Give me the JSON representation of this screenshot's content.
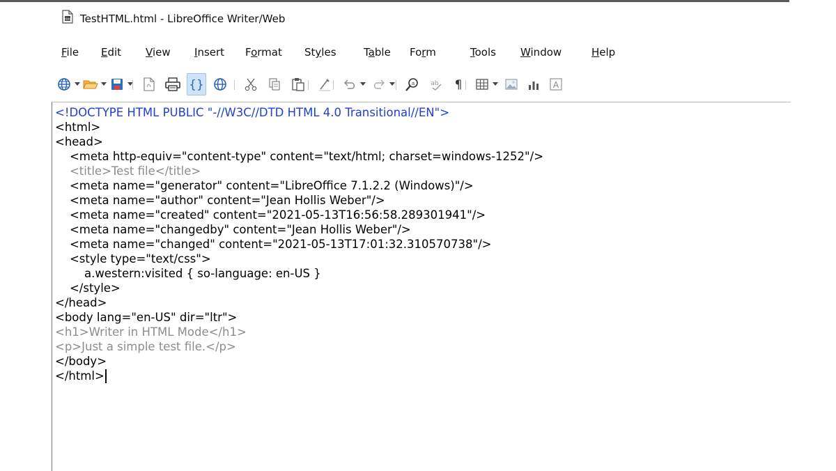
{
  "window": {
    "title": "TestHTML.html - LibreOffice Writer/Web",
    "icon": "writer-web-document-icon"
  },
  "menubar": {
    "items": [
      {
        "label": "File",
        "accel_index": 0
      },
      {
        "label": "Edit",
        "accel_index": 0
      },
      {
        "label": "View",
        "accel_index": 0
      },
      {
        "label": "Insert",
        "accel_index": 0
      },
      {
        "label": "Format",
        "accel_index": 1
      },
      {
        "label": "Styles",
        "accel_index": 2
      },
      {
        "label": "Table",
        "accel_index": 1
      },
      {
        "label": "Form",
        "accel_index": 2
      },
      {
        "label": "Tools",
        "accel_index": 0
      },
      {
        "label": "Window",
        "accel_index": 0
      },
      {
        "label": "Help",
        "accel_index": 0
      }
    ]
  },
  "toolbar": {
    "buttons": [
      "new-document-icon",
      "open-folder-icon",
      "save-icon",
      "export-pdf-icon",
      "print-icon",
      "html-source-icon",
      "web-view-icon",
      "cut-icon",
      "copy-icon",
      "paste-icon",
      "clone-formatting-icon",
      "undo-icon",
      "redo-icon",
      "find-replace-icon",
      "spelling-icon",
      "formatting-marks-icon",
      "insert-table-icon",
      "insert-image-icon",
      "insert-chart-icon",
      "insert-textbox-icon"
    ],
    "active": "html-source-icon"
  },
  "editor": {
    "lines": [
      {
        "text": "<!DOCTYPE HTML PUBLIC \"-//W3C//DTD HTML 4.0 Transitional//EN\">",
        "style": "doctype"
      },
      {
        "text": "<html>",
        "style": "tag"
      },
      {
        "text": "<head>",
        "style": "tag"
      },
      {
        "text": "    <meta http-equiv=\"content-type\" content=\"text/html; charset=windows-1252\"/>",
        "style": "tag"
      },
      {
        "text": "    <title>Test file</title>",
        "style": "gray"
      },
      {
        "text": "    <meta name=\"generator\" content=\"LibreOffice 7.1.2.2 (Windows)\"/>",
        "style": "tag"
      },
      {
        "text": "    <meta name=\"author\" content=\"Jean Hollis Weber\"/>",
        "style": "tag"
      },
      {
        "text": "    <meta name=\"created\" content=\"2021-05-13T16:56:58.289301941\"/>",
        "style": "tag"
      },
      {
        "text": "    <meta name=\"changedby\" content=\"Jean Hollis Weber\"/>",
        "style": "tag"
      },
      {
        "text": "    <meta name=\"changed\" content=\"2021-05-13T17:01:32.310570738\"/>",
        "style": "tag"
      },
      {
        "text": "    <style type=\"text/css\">",
        "style": "tag"
      },
      {
        "text": "        a.western:visited { so-language: en-US }",
        "style": "tag"
      },
      {
        "text": "    </style>",
        "style": "tag"
      },
      {
        "text": "</head>",
        "style": "tag"
      },
      {
        "text": "<body lang=\"en-US\" dir=\"ltr\">",
        "style": "tag"
      },
      {
        "text": "<h1>Writer in HTML Mode</h1>",
        "style": "gray"
      },
      {
        "text": "<p>Just a simple test file.</p>",
        "style": "gray"
      },
      {
        "text": "</body>",
        "style": "tag"
      },
      {
        "text": "</html>",
        "style": "tag",
        "cursor": true
      }
    ]
  }
}
